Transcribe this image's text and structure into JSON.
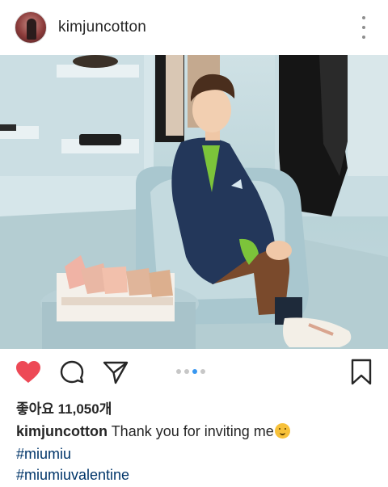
{
  "post": {
    "username": "kimjuncotton",
    "likes_label": "좋아요 11,050개",
    "caption_user": "kimjuncotton",
    "caption_text": "Thank you for inviting me",
    "hashtags": [
      "#miumiu",
      "#miumiuvalentine"
    ],
    "carousel": {
      "count": 4,
      "active_index": 2
    }
  },
  "icons": {
    "avatar": "profile-avatar",
    "more": "more-options-icon",
    "like": "heart-icon",
    "comment": "comment-icon",
    "share": "send-icon",
    "save": "bookmark-icon",
    "emoji": "smiling-face-emoji"
  },
  "colors": {
    "like": "#ed4956",
    "hashtag": "#003569",
    "carousel_active": "#3897f0",
    "carousel_inactive": "#c7c7c7"
  }
}
